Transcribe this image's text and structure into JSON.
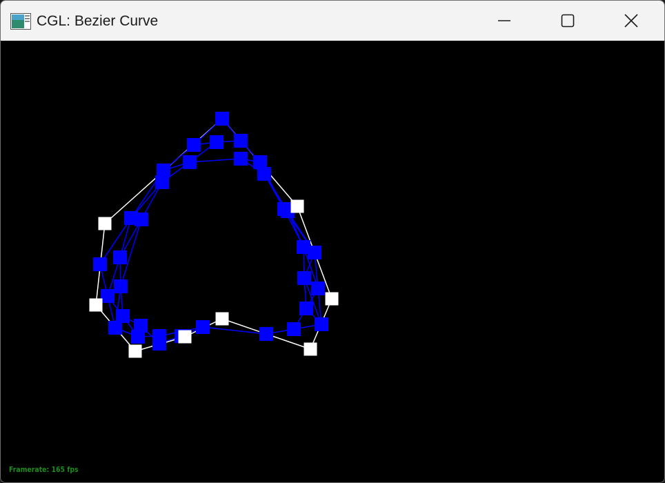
{
  "window": {
    "title": "CGL: Bezier Curve",
    "icons": {
      "app": "app-window-icon",
      "minimize": "minimize-icon",
      "maximize": "maximize-icon",
      "close": "close-icon"
    }
  },
  "status": {
    "framerate": "Framerate: 165 fps"
  },
  "colors": {
    "titlebar": "#f3f3f3",
    "canvas": "#000000",
    "control_points": "#ffffff",
    "curve_points": "#0000ff",
    "framerate_text": "#1e8c1e"
  }
}
